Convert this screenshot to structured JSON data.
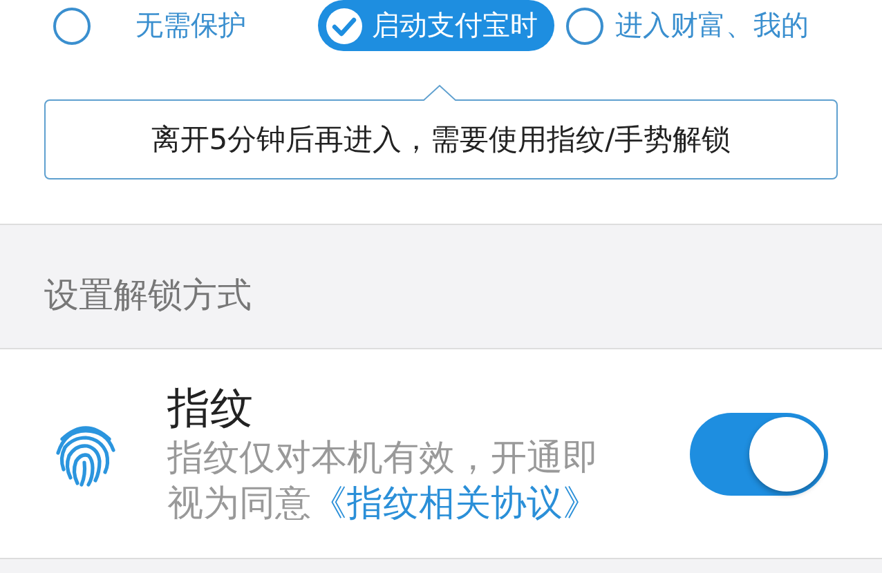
{
  "protection_options": [
    {
      "label": "无需保护",
      "selected": false
    },
    {
      "label": "启动支付宝时",
      "selected": true
    },
    {
      "label": "进入财富、我的",
      "selected": false
    }
  ],
  "tooltip": "离开5分钟后再进入，需要使用指纹/手势解锁",
  "section_header": "设置解锁方式",
  "unlock_item": {
    "title": "指纹",
    "description": "指纹仅对本机有效，开通即视为同意",
    "link": "《指纹相关协议》",
    "on": true
  }
}
